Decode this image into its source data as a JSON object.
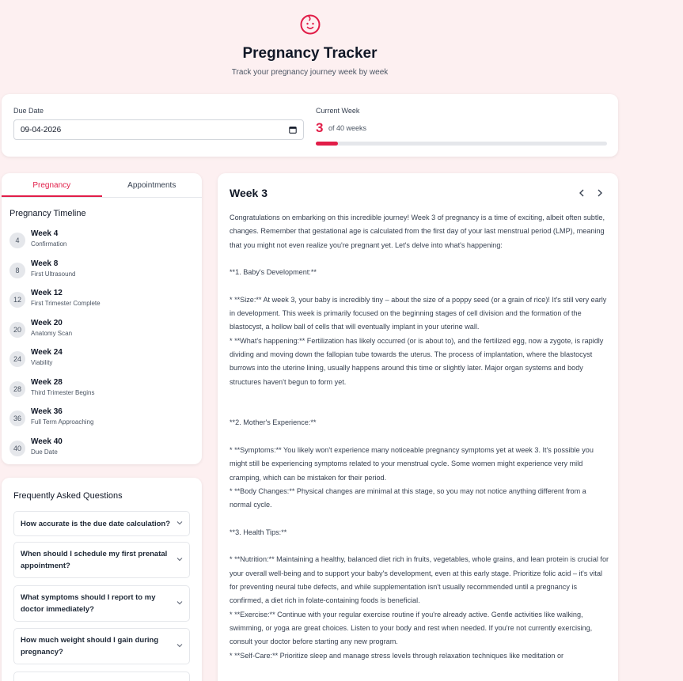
{
  "header": {
    "logo_icon": "baby-face-icon",
    "title": "Pregnancy Tracker",
    "subtitle": "Track your pregnancy journey week by week"
  },
  "due_date": {
    "label": "Due Date",
    "value": "09-04-2026",
    "icon": "calendar-icon"
  },
  "current_week": {
    "label": "Current Week",
    "value": "3",
    "of_text": "of 40 weeks",
    "progress_fraction": 0.075
  },
  "tabs": [
    {
      "label": "Pregnancy",
      "active": true
    },
    {
      "label": "Appointments",
      "active": false
    }
  ],
  "timeline": {
    "title": "Pregnancy Timeline",
    "items": [
      {
        "num": "4",
        "week": "Week 4",
        "desc": "Confirmation"
      },
      {
        "num": "8",
        "week": "Week 8",
        "desc": "First Ultrasound"
      },
      {
        "num": "12",
        "week": "Week 12",
        "desc": "First Trimester Complete"
      },
      {
        "num": "20",
        "week": "Week 20",
        "desc": "Anatomy Scan"
      },
      {
        "num": "24",
        "week": "Week 24",
        "desc": "Viability"
      },
      {
        "num": "28",
        "week": "Week 28",
        "desc": "Third Trimester Begins"
      },
      {
        "num": "36",
        "week": "Week 36",
        "desc": "Full Term Approaching"
      },
      {
        "num": "40",
        "week": "Week 40",
        "desc": "Due Date"
      }
    ]
  },
  "faq": {
    "title": "Frequently Asked Questions",
    "items": [
      "How accurate is the due date calculation?",
      "When should I schedule my first prenatal appointment?",
      "What symptoms should I report to my doctor immediately?",
      "How much weight should I gain during pregnancy?"
    ]
  },
  "week_detail": {
    "title": "Week 3",
    "prev_icon": "chevron-left-icon",
    "next_icon": "chevron-right-icon",
    "intro": "Congratulations on embarking on this incredible journey! Week 3 of pregnancy is a time of exciting, albeit often subtle, changes. Remember that gestational age is calculated from the first day of your last menstrual period (LMP), meaning that you might not even realize you're pregnant yet. Let's delve into what's happening:",
    "s1_heading": "**1. Baby's Development:**",
    "s1_p1": "* **Size:** At week 3, your baby is incredibly tiny – about the size of a poppy seed (or a grain of rice)! It's still very early in development. This week is primarily focused on the beginning stages of cell division and the formation of the blastocyst, a hollow ball of cells that will eventually implant in your uterine wall.",
    "s1_p2": "* **What's happening:** Fertilization has likely occurred (or is about to), and the fertilized egg, now a zygote, is rapidly dividing and moving down the fallopian tube towards the uterus. The process of implantation, where the blastocyst burrows into the uterine lining, usually happens around this time or slightly later. Major organ systems and body structures haven't begun to form yet.",
    "s2_heading": "**2. Mother's Experience:**",
    "s2_p1": "* **Symptoms:** You likely won't experience many noticeable pregnancy symptoms yet at week 3. It's possible you might still be experiencing symptoms related to your menstrual cycle. Some women might experience very mild cramping, which can be mistaken for their period.",
    "s2_p2": "* **Body Changes:** Physical changes are minimal at this stage, so you may not notice anything different from a normal cycle.",
    "s3_heading": "**3. Health Tips:**",
    "s3_p1": "* **Nutrition:** Maintaining a healthy, balanced diet rich in fruits, vegetables, whole grains, and lean protein is crucial for your overall well-being and to support your baby's development, even at this early stage. Prioritize folic acid – it's vital for preventing neural tube defects, and while supplementation isn't usually recommended until a pregnancy is confirmed, a diet rich in folate-containing foods is beneficial.",
    "s3_p2": "* **Exercise:** Continue with your regular exercise routine if you're already active. Gentle activities like walking, swimming, or yoga are great choices. Listen to your body and rest when needed. If you're not currently exercising, consult your doctor before starting any new program.",
    "s3_p3": "* **Self-Care:** Prioritize sleep and manage stress levels through relaxation techniques like meditation or"
  },
  "colors": {
    "accent": "#e11d48",
    "background": "#fdf0f1"
  }
}
